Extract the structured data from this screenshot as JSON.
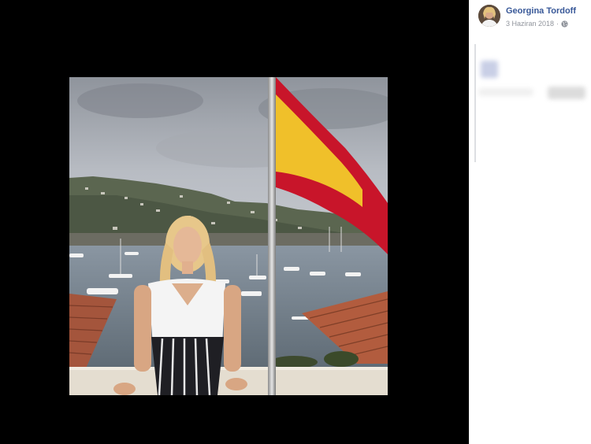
{
  "post": {
    "author_name": "Georgina Tordoff",
    "date": "3 Haziran 2018",
    "separator": "·",
    "privacy_icon": "globe-icon",
    "avatar_icon": "avatar-photo"
  },
  "photo": {
    "icon": "photo-image"
  },
  "colors": {
    "author_link": "#385898",
    "meta_text": "#90949c",
    "viewer_bg": "#000000",
    "flag_red": "#c8152a",
    "flag_yellow": "#f0c02a"
  }
}
